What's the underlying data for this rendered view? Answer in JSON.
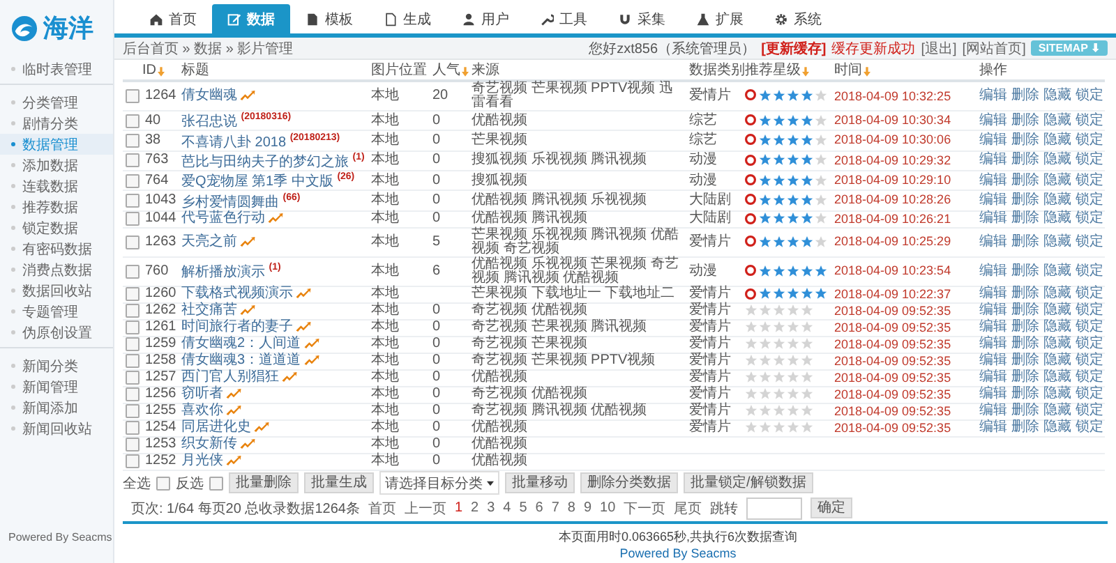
{
  "logo": {
    "text": "海洋"
  },
  "nav": [
    {
      "label": "首页",
      "selected": false
    },
    {
      "label": "数据",
      "selected": true
    },
    {
      "label": "模板",
      "selected": false
    },
    {
      "label": "生成",
      "selected": false
    },
    {
      "label": "用户",
      "selected": false
    },
    {
      "label": "工具",
      "selected": false
    },
    {
      "label": "采集",
      "selected": false
    },
    {
      "label": "扩展",
      "selected": false
    },
    {
      "label": "系统",
      "selected": false
    }
  ],
  "breadcrumb": "后台首页 » 数据 » 影片管理",
  "user_bar": {
    "greeting": "您好zxt856（系统管理员）",
    "refresh_cache": "[更新缓存]",
    "cache_status": "缓存更新成功",
    "logout": "[退出]",
    "site_home": "[网站首页]",
    "sitemap": "SITEMAP ⬇"
  },
  "sidebar": {
    "items": [
      {
        "label": "临时表管理",
        "selected": false,
        "divider_after": true
      },
      {
        "label": "分类管理",
        "selected": false
      },
      {
        "label": "剧情分类",
        "selected": false
      },
      {
        "label": "数据管理",
        "selected": true
      },
      {
        "label": "添加数据",
        "selected": false
      },
      {
        "label": "连载数据",
        "selected": false
      },
      {
        "label": "推荐数据",
        "selected": false
      },
      {
        "label": "锁定数据",
        "selected": false
      },
      {
        "label": "有密码数据",
        "selected": false
      },
      {
        "label": "消费点数据",
        "selected": false
      },
      {
        "label": "数据回收站",
        "selected": false
      },
      {
        "label": "专题管理",
        "selected": false
      },
      {
        "label": "伪原创设置",
        "selected": false,
        "divider_after": true
      },
      {
        "label": "新闻分类",
        "selected": false
      },
      {
        "label": "新闻管理",
        "selected": false
      },
      {
        "label": "新闻添加",
        "selected": false
      },
      {
        "label": "新闻回收站",
        "selected": false
      }
    ],
    "powered": "Powered By Seacms"
  },
  "table": {
    "columns": [
      {
        "label": "ID",
        "sortable": true
      },
      {
        "label": "标题",
        "sortable": false
      },
      {
        "label": "图片位置",
        "sortable": false
      },
      {
        "label": "人气",
        "sortable": true
      },
      {
        "label": "来源",
        "sortable": false
      },
      {
        "label": "数据类别",
        "sortable": false
      },
      {
        "label": "推荐星级",
        "sortable": true
      },
      {
        "label": "时间",
        "sortable": true
      },
      {
        "label": "操作",
        "sortable": false
      }
    ],
    "rows": [
      {
        "checked": false,
        "id": "1264",
        "title": "倩女幽魂",
        "hot": true,
        "picture": "本地",
        "popularity": "20",
        "source": "奇艺视频 芒果视频 PPTV视频 迅雷看看",
        "category": "爱情片",
        "recommended": true,
        "stars": 4,
        "time": "2018-04-09 10:32:25",
        "actions": [
          "编辑",
          "删除",
          "隐藏",
          "锁定"
        ]
      },
      {
        "checked": false,
        "id": "40",
        "title": "张召忠说 $^{(20180316)}$",
        "hot": false,
        "picture": "本地",
        "popularity": "0",
        "source": "优酷视频",
        "category": "综艺",
        "recommended": true,
        "stars": 4,
        "time": "2018-04-09 10:30:34",
        "actions": [
          "编辑",
          "删除",
          "隐藏",
          "锁定"
        ]
      },
      {
        "checked": false,
        "id": "38",
        "title": "不喜请八卦 2018 $^{(20180213)}$",
        "hot": false,
        "picture": "本地",
        "popularity": "0",
        "source": "芒果视频",
        "category": "综艺",
        "recommended": true,
        "stars": 4,
        "time": "2018-04-09 10:30:06",
        "actions": [
          "编辑",
          "删除",
          "隐藏",
          "锁定"
        ]
      },
      {
        "checked": false,
        "id": "763",
        "title": "芭比与田纳夫子的梦幻之旅 $^{(1)}$",
        "hot": false,
        "picture": "本地",
        "popularity": "0",
        "source": "搜狐视频 乐视视频 腾讯视频",
        "category": "动漫",
        "recommended": true,
        "stars": 4,
        "time": "2018-04-09 10:29:32",
        "actions": [
          "编辑",
          "删除",
          "隐藏",
          "锁定"
        ]
      },
      {
        "checked": false,
        "id": "764",
        "title": "爱Q宠物屋 第1季 中文版 $^{(26)}$",
        "hot": false,
        "picture": "本地",
        "popularity": "0",
        "source": "搜狐视频",
        "category": "动漫",
        "recommended": true,
        "stars": 4,
        "time": "2018-04-09 10:29:10",
        "actions": [
          "编辑",
          "删除",
          "隐藏",
          "锁定"
        ]
      },
      {
        "checked": false,
        "id": "1043",
        "title": "乡村爱情圆舞曲 $^{(66)}$",
        "hot": false,
        "picture": "本地",
        "popularity": "0",
        "source": "优酷视频 腾讯视频 乐视视频",
        "category": "大陆剧",
        "recommended": true,
        "stars": 4,
        "time": "2018-04-09 10:28:26",
        "actions": [
          "编辑",
          "删除",
          "隐藏",
          "锁定"
        ]
      },
      {
        "checked": false,
        "id": "1044",
        "title": "代号蓝色行动",
        "hot": true,
        "picture": "本地",
        "popularity": "0",
        "source": "优酷视频 腾讯视频",
        "category": "大陆剧",
        "recommended": true,
        "stars": 4,
        "time": "2018-04-09 10:26:21",
        "actions": [
          "编辑",
          "删除",
          "隐藏",
          "锁定"
        ]
      },
      {
        "checked": false,
        "id": "1263",
        "title": "天亮之前",
        "hot": true,
        "picture": "本地",
        "popularity": "5",
        "source": "芒果视频 乐视视频 腾讯视频 优酷视频 奇艺视频",
        "category": "爱情片",
        "recommended": true,
        "stars": 4,
        "time": "2018-04-09 10:25:29",
        "actions": [
          "编辑",
          "删除",
          "隐藏",
          "锁定"
        ]
      },
      {
        "checked": false,
        "id": "760",
        "title": "解析播放演示 $^{(1)}$",
        "hot": false,
        "picture": "本地",
        "popularity": "6",
        "source": "优酷视频 乐视视频 芒果视频 奇艺视频 腾讯视频 优酷视频",
        "category": "动漫",
        "recommended": true,
        "stars": 5,
        "time": "2018-04-09 10:23:54",
        "actions": [
          "编辑",
          "删除",
          "隐藏",
          "锁定"
        ]
      },
      {
        "checked": false,
        "id": "1260",
        "title": "下载格式视频演示",
        "hot": true,
        "picture": "本地",
        "source": "芒果视频 下载地址一 下载地址二",
        "category": "爱情片",
        "recommended": true,
        "stars": 5,
        "time": "2018-04-09 10:22:37",
        "actions": [
          "编辑",
          "删除",
          "隐藏",
          "锁定"
        ]
      },
      {
        "checked": false,
        "id": "1262",
        "title": "社交痛苦",
        "hot": true,
        "picture": "本地",
        "popularity": "0",
        "source": "奇艺视频 优酷视频",
        "category": "爱情片",
        "recommended": false,
        "stars": 0,
        "time": "2018-04-09 09:52:35",
        "actions": [
          "编辑",
          "删除",
          "隐藏",
          "锁定"
        ]
      },
      {
        "checked": false,
        "id": "1261",
        "title": "时间旅行者的妻子",
        "hot": true,
        "picture": "本地",
        "popularity": "0",
        "source": "奇艺视频 芒果视频 腾讯视频",
        "category": "爱情片",
        "recommended": false,
        "stars": 0,
        "time": "2018-04-09 09:52:35",
        "actions": [
          "编辑",
          "删除",
          "隐藏",
          "锁定"
        ]
      },
      {
        "checked": false,
        "id": "1259",
        "title": "倩女幽魂2：人间道",
        "hot": true,
        "picture": "本地",
        "popularity": "0",
        "source": "奇艺视频 芒果视频",
        "category": "爱情片",
        "recommended": false,
        "stars": 0,
        "time": "2018-04-09 09:52:35",
        "actions": [
          "编辑",
          "删除",
          "隐藏",
          "锁定"
        ]
      },
      {
        "checked": false,
        "id": "1258",
        "title": "倩女幽魂3：道道道",
        "hot": true,
        "picture": "本地",
        "popularity": "0",
        "source": "奇艺视频 芒果视频 PPTV视频",
        "category": "爱情片",
        "recommended": false,
        "stars": 0,
        "time": "2018-04-09 09:52:35",
        "actions": [
          "编辑",
          "删除",
          "隐藏",
          "锁定"
        ]
      },
      {
        "checked": false,
        "id": "1257",
        "title": "西门官人别猖狂",
        "hot": true,
        "picture": "本地",
        "popularity": "0",
        "source": "优酷视频",
        "category": "爱情片",
        "recommended": false,
        "stars": 0,
        "time": "2018-04-09 09:52:35",
        "actions": [
          "编辑",
          "删除",
          "隐藏",
          "锁定"
        ]
      },
      {
        "checked": false,
        "id": "1256",
        "title": "窃听者",
        "hot": true,
        "picture": "本地",
        "popularity": "0",
        "source": "奇艺视频 优酷视频",
        "category": "爱情片",
        "recommended": false,
        "stars": 0,
        "time": "2018-04-09 09:52:35",
        "actions": [
          "编辑",
          "删除",
          "隐藏",
          "锁定"
        ]
      },
      {
        "checked": false,
        "id": "1255",
        "title": "喜欢你",
        "hot": true,
        "picture": "本地",
        "popularity": "0",
        "source": "奇艺视频 腾讯视频 优酷视频",
        "category": "爱情片",
        "recommended": false,
        "stars": 0,
        "time": "2018-04-09 09:52:35",
        "actions": [
          "编辑",
          "删除",
          "隐藏",
          "锁定"
        ]
      },
      {
        "checked": false,
        "id": "1254",
        "title": "同居进化史",
        "hot": true,
        "picture": "本地",
        "popularity": "0",
        "source": "优酷视频",
        "category": "爱情片",
        "recommended": false,
        "stars": 0,
        "time": "2018-04-09 09:52:35",
        "actions": [
          "编辑",
          "删除",
          "隐藏",
          "锁定"
        ]
      },
      {
        "checked": false,
        "id": "1253",
        "title": "织女新传",
        "hot": true,
        "picture": "本地",
        "popularity": "0",
        "source": "优酷视频"
      },
      {
        "checked": false,
        "id": "1252",
        "title": "月光侠",
        "hot": true,
        "picture": "本地",
        "popularity": "0",
        "source": "优酷视频"
      }
    ]
  },
  "bulk_bar": [
    {
      "kind": "checkbox",
      "label": "全选",
      "checked": false
    },
    {
      "kind": "checkbox",
      "label": "反选",
      "checked": false
    },
    {
      "kind": "button",
      "label": "批量删除"
    },
    {
      "kind": "button",
      "label": "批量生成"
    },
    {
      "kind": "dropdown",
      "label": "请选择目标分类"
    },
    {
      "kind": "button",
      "label": "批量移动"
    },
    {
      "kind": "button",
      "label": "删除分类数据"
    },
    {
      "kind": "button",
      "label": "批量锁定/解锁数据"
    }
  ],
  "pager": {
    "summary": "页次: 1/64 每页20 总收录数据1264条",
    "first": "首页",
    "prev": "上一页",
    "pages": [
      {
        "label": "1",
        "selected": true
      },
      {
        "label": "2",
        "selected": false
      },
      {
        "label": "3",
        "selected": false
      },
      {
        "label": "4",
        "selected": false
      },
      {
        "label": "5",
        "selected": false
      },
      {
        "label": "6",
        "selected": false
      },
      {
        "label": "7",
        "selected": false
      },
      {
        "label": "8",
        "selected": false
      },
      {
        "label": "9",
        "selected": false
      },
      {
        "label": "10",
        "selected": false
      }
    ],
    "next": "下一页",
    "last": "尾页",
    "jump": "跳转",
    "confirm": "确定"
  },
  "footer": {
    "stats": "本页面用时0.063665秒,共执行6次数据查询",
    "powered": "Powered By Seacms"
  }
}
